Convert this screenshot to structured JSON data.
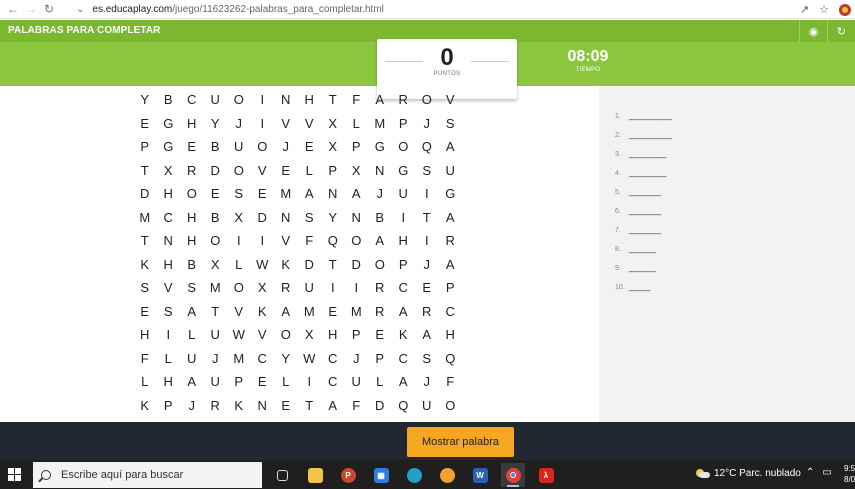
{
  "browser": {
    "url_host": "es.educaplay.com",
    "url_path": "/juego/11623262-palabras_para_completar.html"
  },
  "header": {
    "title": "PALABRAS PARA COMPLETAR",
    "score": "0",
    "score_label": "PUNTOS",
    "time": "08:09",
    "time_label": "TIEMPO"
  },
  "grid": [
    [
      "Y",
      "B",
      "C",
      "U",
      "O",
      "I",
      "N",
      "H",
      "T",
      "F",
      "A",
      "R",
      "O",
      "V"
    ],
    [
      "E",
      "G",
      "H",
      "Y",
      "J",
      "I",
      "V",
      "V",
      "X",
      "L",
      "M",
      "P",
      "J",
      "S"
    ],
    [
      "P",
      "G",
      "E",
      "B",
      "U",
      "O",
      "J",
      "E",
      "X",
      "P",
      "G",
      "O",
      "Q",
      "A"
    ],
    [
      "T",
      "X",
      "R",
      "D",
      "O",
      "V",
      "E",
      "L",
      "P",
      "X",
      "N",
      "G",
      "S",
      "U"
    ],
    [
      "D",
      "H",
      "O",
      "E",
      "S",
      "E",
      "M",
      "A",
      "N",
      "A",
      "J",
      "U",
      "I",
      "G"
    ],
    [
      "M",
      "C",
      "H",
      "B",
      "X",
      "D",
      "N",
      "S",
      "Y",
      "N",
      "B",
      "I",
      "T",
      "A"
    ],
    [
      "T",
      "N",
      "H",
      "O",
      "I",
      "I",
      "V",
      "F",
      "Q",
      "O",
      "A",
      "H",
      "I",
      "R"
    ],
    [
      "K",
      "H",
      "B",
      "X",
      "L",
      "W",
      "K",
      "D",
      "T",
      "D",
      "O",
      "P",
      "J",
      "A"
    ],
    [
      "S",
      "V",
      "S",
      "M",
      "O",
      "X",
      "R",
      "U",
      "I",
      "I",
      "R",
      "C",
      "E",
      "P"
    ],
    [
      "E",
      "S",
      "A",
      "T",
      "V",
      "K",
      "A",
      "M",
      "E",
      "M",
      "R",
      "A",
      "R",
      "C"
    ],
    [
      "H",
      "I",
      "L",
      "U",
      "W",
      "V",
      "O",
      "X",
      "H",
      "P",
      "E",
      "K",
      "A",
      "H"
    ],
    [
      "F",
      "L",
      "U",
      "J",
      "M",
      "C",
      "Y",
      "W",
      "C",
      "J",
      "P",
      "C",
      "S",
      "Q"
    ],
    [
      "L",
      "H",
      "A",
      "U",
      "P",
      "E",
      "L",
      "I",
      "C",
      "U",
      "L",
      "A",
      "J",
      "F"
    ],
    [
      "K",
      "P",
      "J",
      "R",
      "K",
      "N",
      "E",
      "T",
      "A",
      "F",
      "D",
      "Q",
      "U",
      "O"
    ]
  ],
  "words": [
    {
      "num": "1.",
      "blank": "________"
    },
    {
      "num": "2.",
      "blank": "________"
    },
    {
      "num": "3.",
      "blank": "_______"
    },
    {
      "num": "4.",
      "blank": "_______"
    },
    {
      "num": "5.",
      "blank": "______"
    },
    {
      "num": "6.",
      "blank": "______"
    },
    {
      "num": "7.",
      "blank": "______"
    },
    {
      "num": "8.",
      "blank": "_____"
    },
    {
      "num": "9.",
      "blank": "_____"
    },
    {
      "num": "10.",
      "blank": "____"
    }
  ],
  "actions": {
    "show_word": "Mostrar palabra"
  },
  "taskbar": {
    "search_placeholder": "Escribe aquí para buscar",
    "weather": "12°C  Parc. nublado",
    "clock_time": "9:5",
    "clock_date": "8/0"
  },
  "colors": {
    "header_green": "#8cc63f",
    "button_orange": "#f5a623",
    "bottom_bar": "#222831"
  }
}
